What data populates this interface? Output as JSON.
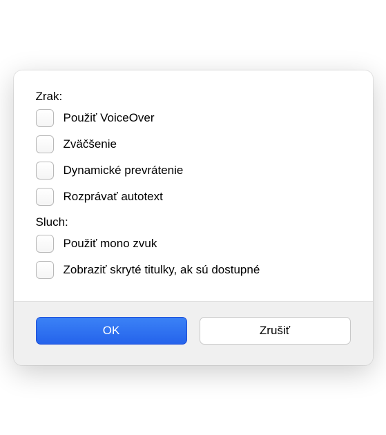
{
  "sections": {
    "vision": {
      "label": "Zrak:",
      "options": [
        {
          "label": "Použiť VoiceOver"
        },
        {
          "label": "Zväčšenie"
        },
        {
          "label": "Dynamické prevrátenie"
        },
        {
          "label": "Rozprávať autotext"
        }
      ]
    },
    "hearing": {
      "label": "Sluch:",
      "options": [
        {
          "label": "Použiť mono zvuk"
        },
        {
          "label": "Zobraziť skryté titulky, ak sú dostupné"
        }
      ]
    }
  },
  "buttons": {
    "ok": "OK",
    "cancel": "Zrušiť"
  }
}
